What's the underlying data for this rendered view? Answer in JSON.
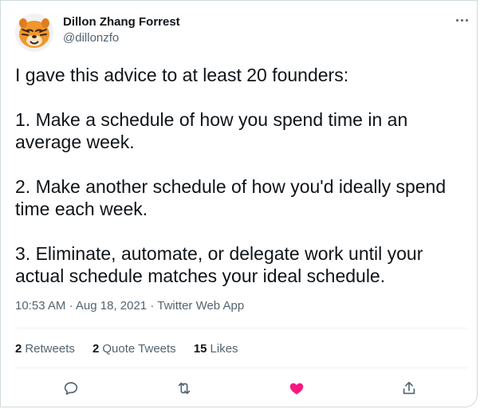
{
  "tweet": {
    "author": {
      "display_name": "Dillon Zhang Forrest",
      "handle": "@dillonzfo",
      "avatar_icon": "tiger-avatar"
    },
    "paragraphs": [
      "I gave this advice to at least 20 founders:",
      "1. Make a schedule of how you spend time in an average week.",
      "2. Make another schedule of how you'd ideally spend time each week.",
      "3. Eliminate, automate, or delegate work until your actual schedule matches your ideal schedule."
    ],
    "meta": {
      "time": "10:53 AM",
      "separator": "·",
      "date": "Aug 18, 2021",
      "source": "Twitter Web App"
    },
    "stats": {
      "retweets_count": "2",
      "retweets_label": "Retweets",
      "quote_count": "2",
      "quote_label": "Quote Tweets",
      "likes_count": "15",
      "likes_label": "Likes"
    },
    "actions": [
      "reply-icon",
      "retweet-icon",
      "like-icon",
      "share-icon"
    ],
    "colors": {
      "text": "#0f1419",
      "secondary": "#536471",
      "like_active": "#f91880",
      "border": "#cfd9de"
    }
  }
}
